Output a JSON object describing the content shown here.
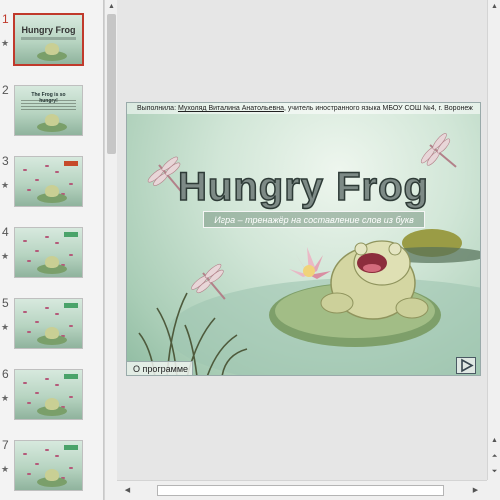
{
  "thumbnails": [
    {
      "number": "1",
      "active": true,
      "starred": true,
      "kind": "title",
      "title": "Hungry Frog"
    },
    {
      "number": "2",
      "active": false,
      "starred": false,
      "kind": "text",
      "title": "The Frog is so hungry!"
    },
    {
      "number": "3",
      "active": false,
      "starred": true,
      "kind": "game",
      "score": "red"
    },
    {
      "number": "4",
      "active": false,
      "starred": true,
      "kind": "game",
      "score": "green"
    },
    {
      "number": "5",
      "active": false,
      "starred": true,
      "kind": "game",
      "score": "green"
    },
    {
      "number": "6",
      "active": false,
      "starred": true,
      "kind": "game",
      "score": "green"
    },
    {
      "number": "7",
      "active": false,
      "starred": true,
      "kind": "game",
      "score": "green"
    }
  ],
  "slide": {
    "credits_prefix": "Выполнила: ",
    "credits_author": "Мухоляд Виталина Анатольевна",
    "credits_suffix": ", учитель иностранного языка МБОУ СОШ №4, г. Воронеж",
    "title": "Hungry Frog",
    "subtitle": "Игра – тренажёр на составление слов из букв",
    "about_button": "О программе"
  },
  "icons": {
    "star": "star-icon",
    "next": "play-triangle-icon",
    "scroll_up": "arrow-up-icon",
    "scroll_down": "arrow-down-icon",
    "scroll_left": "arrow-left-icon",
    "scroll_right": "arrow-right-icon"
  },
  "colors": {
    "active_accent": "#c0392b",
    "slide_bg": "#cfe5d6",
    "title_fill": "#7d8a86"
  }
}
